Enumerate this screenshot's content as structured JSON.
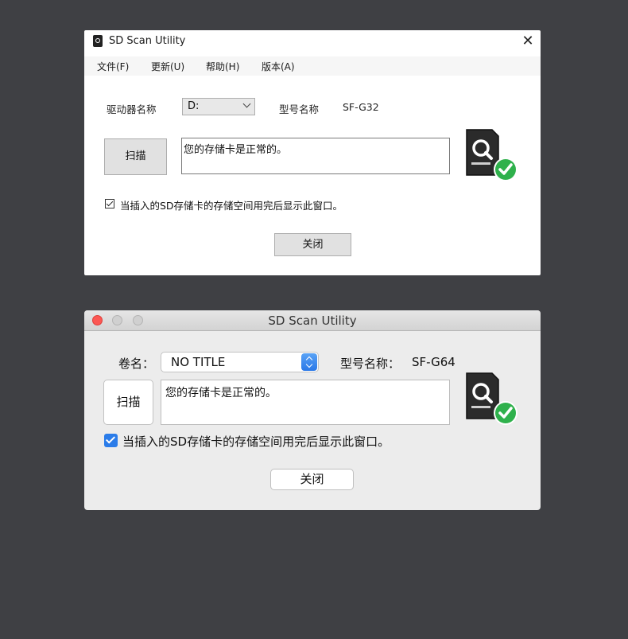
{
  "windows_dialog": {
    "title": "SD Scan Utility",
    "close_glyph": "✕",
    "menu": [
      "文件(F)",
      "更新(U)",
      "帮助(H)",
      "版本(A)"
    ],
    "drive_label": "驱动器名称",
    "drive_value": "D:",
    "model_label": "型号名称",
    "model_value": "SF-G32",
    "scan_button": "扫描",
    "status_text": "您的存储卡是正常的。",
    "show_after_insert_label": "当插入的SD存储卡的存储空间用完后显示此窗口。",
    "show_after_insert_checked": true,
    "close_button": "关闭"
  },
  "mac_dialog": {
    "title": "SD Scan Utility",
    "volume_label": "卷名：",
    "volume_value": "NO TITLE",
    "model_label": "型号名称：",
    "model_value": "SF-G64",
    "scan_button": "扫描",
    "status_text": "您的存储卡是正常的。",
    "show_after_insert_label": "当插入的SD存储卡的存储空间用完后显示此窗口。",
    "show_after_insert_checked": true,
    "close_button": "关闭"
  },
  "card_icon": {
    "name": "sd-card-check-icon",
    "status": "ok",
    "accent_color": "#2fb14c"
  },
  "colors": {
    "background": "#3f4044",
    "mac_checkbox": "#2b7ce9",
    "mac_close_light": "#fc5753"
  }
}
